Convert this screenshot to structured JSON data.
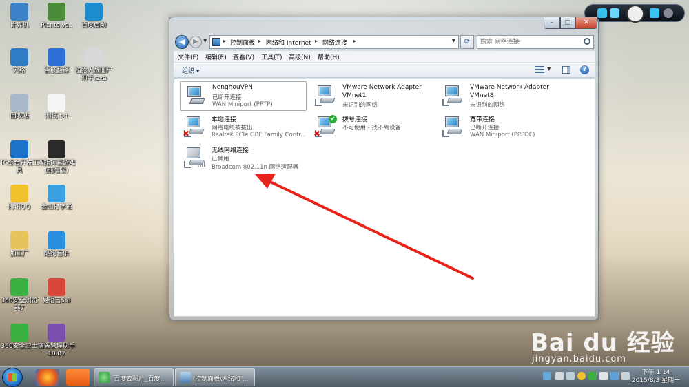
{
  "desktop": {
    "icons": [
      {
        "label": "计算机",
        "color": "#3b82c8"
      },
      {
        "label": "Plants.vs..",
        "color": "#4a8c3a"
      },
      {
        "label": "百度启动",
        "color": "#1b8ccf"
      },
      {
        "label": "网络",
        "color": "#2f7bc4"
      },
      {
        "label": "百度翻译",
        "color": "#2f6fd8"
      },
      {
        "label": "植物大战僵尸助手.exe",
        "color": "#d8d8d8"
      },
      {
        "label": "回收站",
        "color": "#a7b8c9"
      },
      {
        "label": "测试.txt",
        "color": "#f4f4f4"
      },
      {
        "label": "TC综合开发工具",
        "color": "#1c72c8"
      },
      {
        "label": "双指挥官游戏(前瞻版)",
        "color": "#2a2a2a"
      },
      {
        "label": "腾讯QQ",
        "color": "#f2c12e"
      },
      {
        "label": "金山打字通",
        "color": "#3aa0e0"
      },
      {
        "label": "加工厂",
        "color": "#e8c25a"
      },
      {
        "label": "酷狗音乐",
        "color": "#2a8fe0"
      },
      {
        "label": "360安全浏览器7",
        "color": "#3cb043"
      },
      {
        "label": "易语言5.8",
        "color": "#d8473a"
      },
      {
        "label": "360安全卫士",
        "color": "#3cb043"
      },
      {
        "label": "宿舍管理助手10.87",
        "color": "#7a4fb0"
      }
    ]
  },
  "window": {
    "close_glyph": "✕",
    "max_glyph": "□",
    "min_glyph": "–",
    "breadcrumb": [
      "控制面板",
      "网络和 Internet",
      "网络连接"
    ],
    "search_placeholder": "搜索 网络连接",
    "menu": [
      "文件(F)",
      "编辑(E)",
      "查看(V)",
      "工具(T)",
      "高级(N)",
      "帮助(H)"
    ],
    "toolbar_organize": "组织 ▾",
    "help_glyph": "?"
  },
  "connections": [
    {
      "name": "NenghouVPN",
      "status": "已断开连接",
      "device": "WAN Miniport (PPTP)",
      "state": "vpn"
    },
    {
      "name": "VMware Network Adapter VMnet1",
      "status": "未识别的网络",
      "device": "",
      "state": "ok"
    },
    {
      "name": "VMware Network Adapter VMnet8",
      "status": "未识别的网络",
      "device": "",
      "state": "ok"
    },
    {
      "name": "本地连接",
      "status": "网络电缆被拔出",
      "device": "Realtek PCIe GBE Family Contr...",
      "state": "error"
    },
    {
      "name": "拨号连接",
      "status": "不可使用 - 找不到设备",
      "device": "",
      "state": "dial"
    },
    {
      "name": "宽带连接",
      "status": "已断开连接",
      "device": "WAN Miniport (PPPOE)",
      "state": "broadband"
    },
    {
      "name": "无线网络连接",
      "status": "已禁用",
      "device": "Broadcom 802.11n 网络适配器",
      "state": "disabled"
    }
  ],
  "taskbar": {
    "tasks": [
      "百度云图片_百度...",
      "控制面板\\网络和 ..."
    ],
    "time": "下午 1:14",
    "date": "2015/8/3 星期一"
  },
  "watermark": {
    "logo": "Bai du 经验",
    "url": "jingyan.baidu.com"
  }
}
